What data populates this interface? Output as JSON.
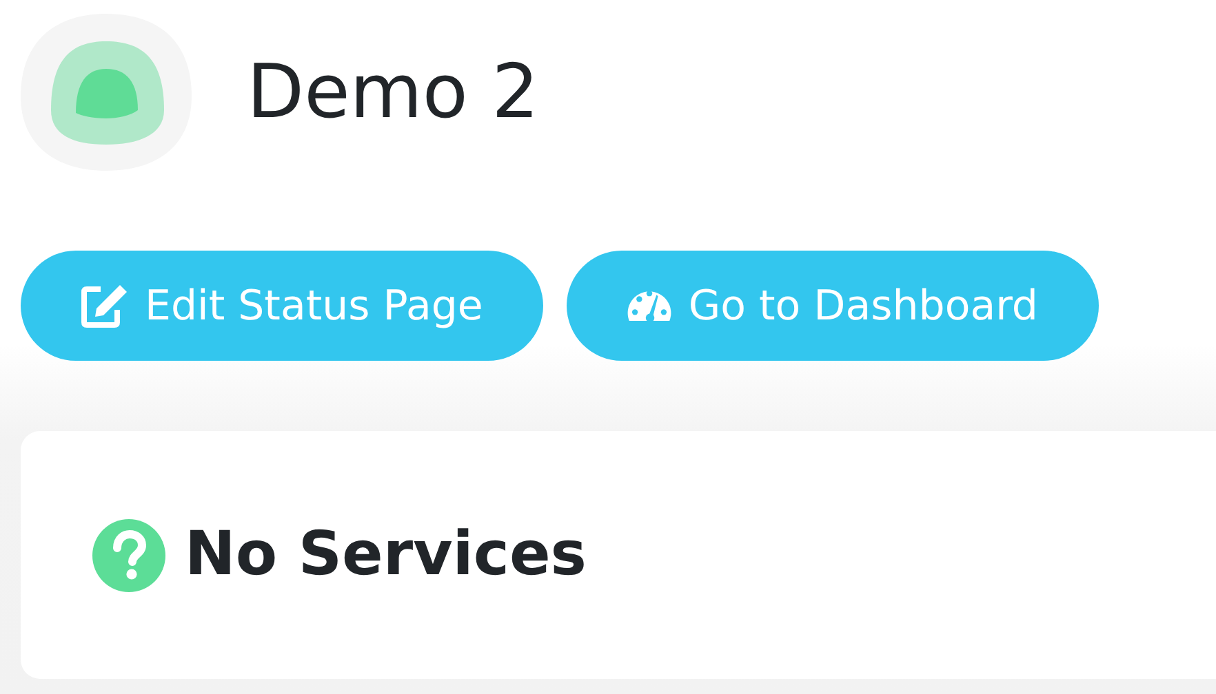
{
  "header": {
    "title": "Demo 2"
  },
  "buttons": [
    {
      "label": "Edit Status Page",
      "kind": "edit"
    },
    {
      "label": "Go to Dashboard",
      "kind": "dashboard"
    }
  ],
  "services_card": {
    "title": "No Services"
  }
}
